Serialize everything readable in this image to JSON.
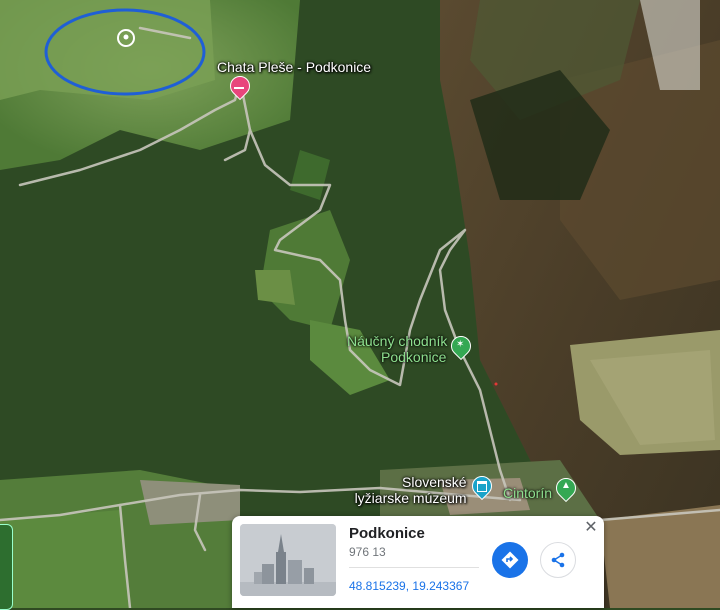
{
  "map": {
    "labels": {
      "chata": "Chata Pleše - Podkonice",
      "chodnik_line1": "Náučný chodník",
      "chodnik_line2": "Podkonice",
      "muzeum_line1": "Slovenské",
      "muzeum_line2": "lyžiarske múzeum",
      "cintorin": "Cintorín"
    }
  },
  "place_card": {
    "name": "Podkonice",
    "postal_code": "976 13",
    "coordinates": "48.815239, 19.243367",
    "close_symbol": "✕",
    "directions_icon": "directions-icon",
    "share_icon": "share-icon"
  },
  "colors": {
    "accent": "#1a73e8",
    "annotation_circle": "#1f5fd6",
    "hotel_pin": "#e8467c",
    "park_pin": "#34a853"
  }
}
